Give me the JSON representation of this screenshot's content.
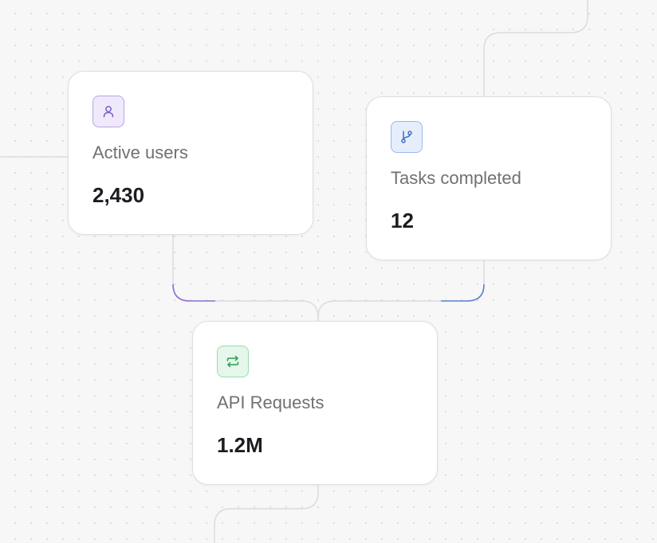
{
  "nodes": {
    "active_users": {
      "label": "Active users",
      "value": "2,430",
      "icon": "user-icon",
      "accent": "#7c5cc4"
    },
    "tasks_completed": {
      "label": "Tasks completed",
      "value": "12",
      "icon": "git-branch-icon",
      "accent": "#3f6fc7"
    },
    "api_requests": {
      "label": "API Requests",
      "value": "1.2M",
      "icon": "repeat-arrows-icon",
      "accent": "#2f9a58"
    }
  },
  "edges": [
    {
      "from": "active_users",
      "to": "api_requests",
      "color": "#8e6fd6"
    },
    {
      "from": "tasks_completed",
      "to": "api_requests",
      "color": "#5a85d8"
    }
  ]
}
